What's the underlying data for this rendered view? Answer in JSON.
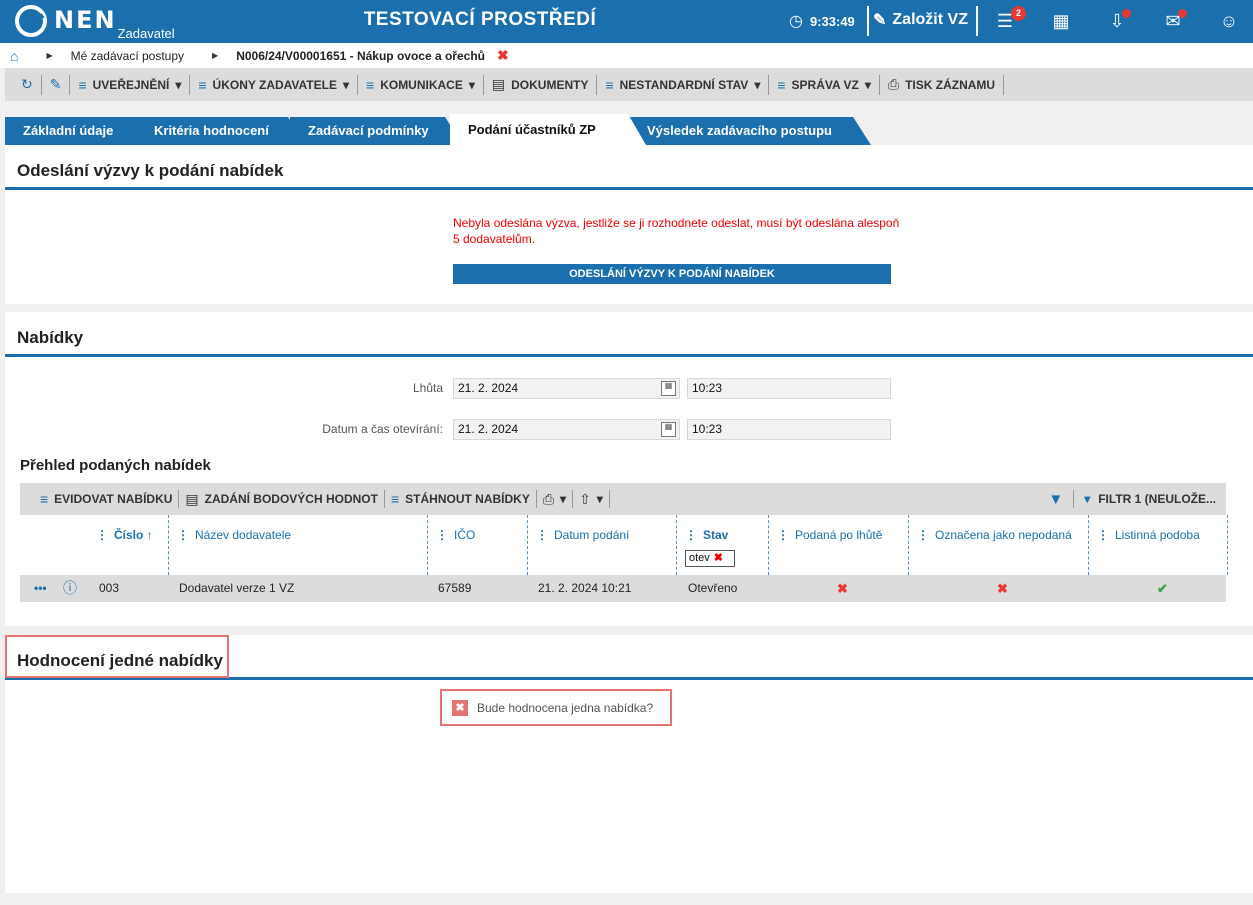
{
  "topbar": {
    "logo": "NEN",
    "logo_sub": "Zadavatel",
    "env_title": "TESTOVACÍ PROSTŘEDÍ",
    "time": "9:33:49",
    "create_label": "Založit VZ",
    "menu_badge": "2",
    "colors": {
      "brand": "#1b6fad",
      "alert": "#e53935"
    }
  },
  "breadcrumb": {
    "items": [
      "Mé zadávací postupy",
      "N006/24/V00001651 - Nákup ovoce a ořechů"
    ]
  },
  "toolbar": {
    "items": [
      "UVEŘEJNĚNÍ",
      "ÚKONY ZADAVATELE",
      "KOMUNIKACE",
      "DOKUMENTY",
      "NESTANDARDNÍ STAV",
      "SPRÁVA VZ",
      "TISK ZÁZNAMU"
    ]
  },
  "tabs": [
    "Základní údaje",
    "Kritéria hodnocení",
    "Zadávací podmínky",
    "Podání účastníků ZP",
    "Výsledek zadávacího postupu"
  ],
  "section1": {
    "title": "Odeslání výzvy k podání nabídek",
    "warning": "Nebyla odeslána výzva, jestliže se ji rozhodnete odeslat, musí být odeslána alespoň 5 dodavatelům.",
    "button": "ODESLÁNÍ VÝZVY K PODÁNÍ NABÍDEK"
  },
  "section2": {
    "title": "Nabídky",
    "lhuta_label": "Lhůta",
    "lhuta_date": "21. 2. 2024",
    "lhuta_time": "10:23",
    "open_label": "Datum a čas otevírání:",
    "open_date": "21. 2. 2024",
    "open_time": "10:23",
    "subtitle": "Přehled podaných nabídek",
    "gridbar": {
      "evidovat": "EVIDOVAT NABÍDKU",
      "zadani": "ZADÁNÍ BODOVÝCH HODNOT",
      "stahnout": "STÁHNOUT NABÍDKY",
      "filter": "FILTR 1 (NEULOŽE..."
    },
    "columns": [
      "Číslo",
      "Název dodavatele",
      "IČO",
      "Datum podání",
      "Stav",
      "Podaná po lhůtě",
      "Označena jako nepodaná",
      "Listinná podoba"
    ],
    "stav_filter": "otev",
    "row": {
      "cislo": "003",
      "nazev": "Dodavatel verze 1 VZ",
      "ico": "67589",
      "datum": "21. 2. 2024 10:21",
      "stav": "Otevřeno"
    }
  },
  "section3": {
    "title": "Hodnocení jedné nabídky",
    "question": "Bude hodnocena jedna nabídka?"
  }
}
